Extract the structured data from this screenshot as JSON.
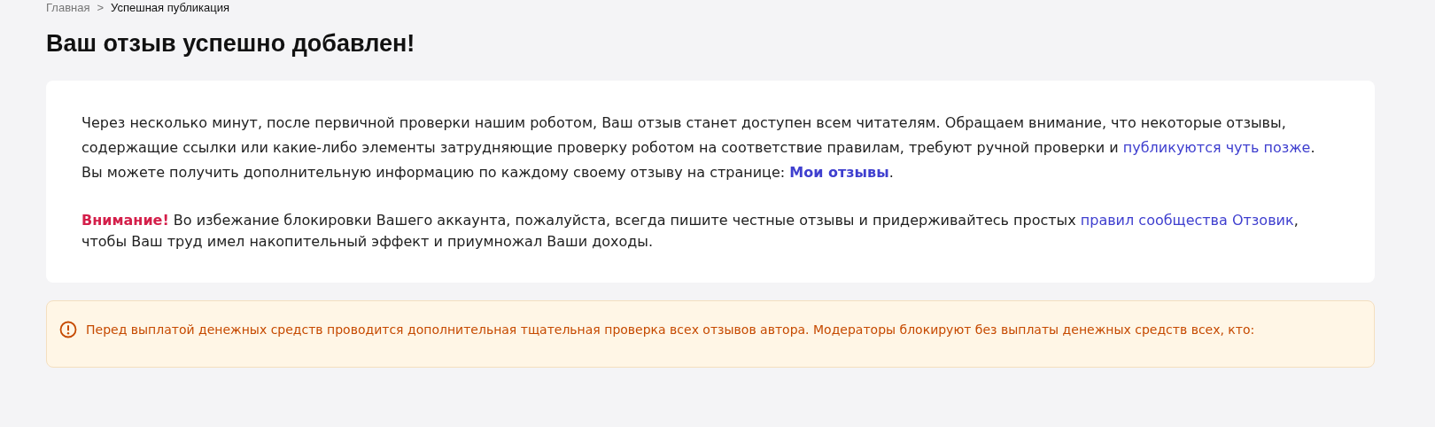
{
  "breadcrumb": [
    {
      "label": "Главная",
      "kind": "link"
    },
    {
      "label": ">",
      "kind": "separator"
    },
    {
      "label": "Успешная публикация",
      "kind": "current"
    }
  ],
  "title": "Ваш отзыв успешно добавлен!",
  "notice": {
    "paragraphs": [
      [
        {
          "kind": "text",
          "text": "Через несколько минут, после первичной проверки нашим роботом, Ваш отзыв станет доступен всем читателям. Обращаем внимание, что некоторые отзывы, содержащие ссылки или какие-либо элементы затрудняющие проверку роботом на соответствие правилам, требуют ручной проверки и "
        },
        {
          "kind": "link",
          "text": "публикуются чуть позже"
        },
        {
          "kind": "text",
          "text": ". Вы можете получить дополнительную информацию по каждому своему отзыву на странице: "
        },
        {
          "kind": "strong-link",
          "text": "Мои отзывы"
        },
        {
          "kind": "text",
          "text": "."
        }
      ],
      [
        {
          "kind": "alert",
          "text": "Внимание!"
        },
        {
          "kind": "text",
          "text": " Во избежание блокировки Вашего аккаунта, пожалуйста, всегда пишите честные отзывы и придерживайтесь простых "
        },
        {
          "kind": "link",
          "text": "правил сообщества Отзовик"
        },
        {
          "kind": "text",
          "text": ", чтобы Ваш труд имел накопительный эффект и приумножал Ваши доходы."
        }
      ]
    ]
  },
  "warning": {
    "text": "Перед выплатой денежных средств проводится дополнительная тщательная проверка всех отзывов автора. Модераторы блокируют без выплаты денежных средств всех, кто:"
  }
}
